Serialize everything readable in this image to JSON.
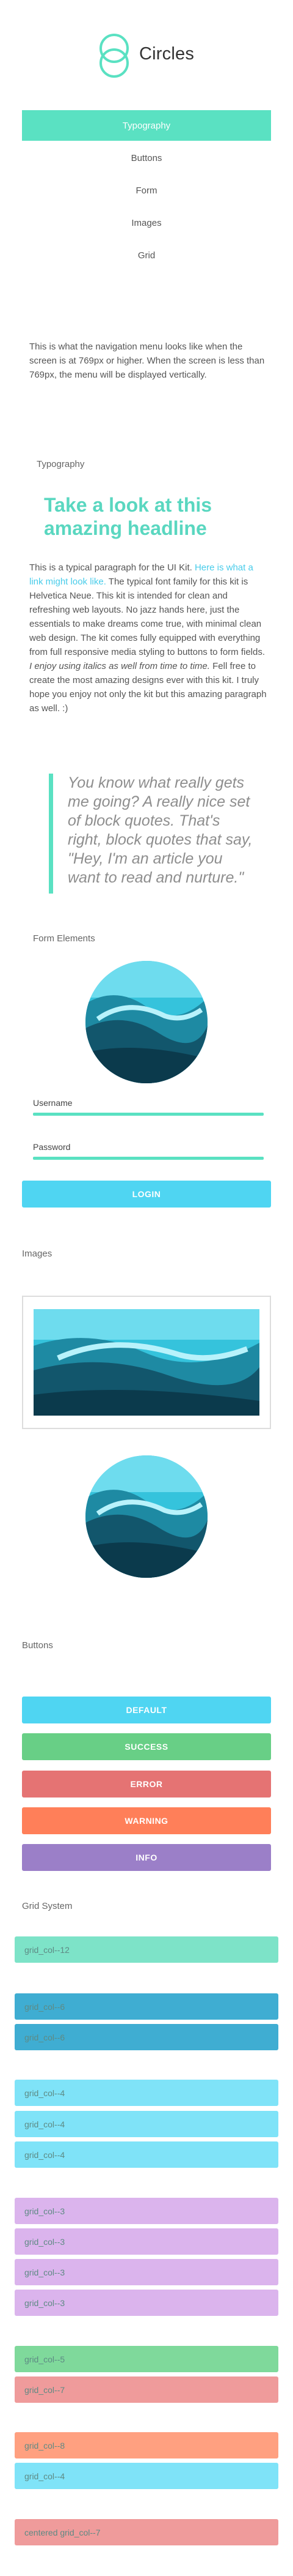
{
  "brand": {
    "name": "Circles"
  },
  "nav": {
    "items": [
      {
        "label": "Typography",
        "active": true
      },
      {
        "label": "Buttons"
      },
      {
        "label": "Form"
      },
      {
        "label": "Images"
      },
      {
        "label": "Grid"
      }
    ]
  },
  "nav_note": "This is what the navigation menu looks like when the screen is at 769px or higher. When the screen is less than 769px, the menu will be displayed vertically.",
  "typography": {
    "section_label": "Typography",
    "headline": "Take a look at this amazing headline",
    "paragraph": {
      "intro": "This is a typical paragraph for the UI Kit. ",
      "link": "Here is what a link might look like.",
      "body1": " The typical font family for this kit is Helvetica Neue. This kit is intended for clean and refreshing web layouts. No jazz hands here, just the essentials to make dreams come true, with minimal clean web design. The kit comes fully equipped with everything from full responsive media styling to buttons to form fields. ",
      "italic": "I enjoy using italics as well from time to time.",
      "body2": " Fell free to create the most amazing designs ever with this kit. I truly hope you enjoy not only the kit but this amazing paragraph as well. :)"
    },
    "quote": "You know what really gets me going? A really nice set of block quotes. That's right, block quotes that say, \"Hey, I'm an article you want to read and nurture.\""
  },
  "form": {
    "section_label": "Form Elements",
    "username_label": "Username",
    "password_label": "Password",
    "login_label": "LOGIN"
  },
  "images": {
    "section_label": "Images"
  },
  "buttons": {
    "section_label": "Buttons",
    "items": [
      {
        "label": "DEFAULT",
        "color": "#4fd5f2"
      },
      {
        "label": "SUCCESS",
        "color": "#68cf86"
      },
      {
        "label": "ERROR",
        "color": "#e57373"
      },
      {
        "label": "WARNING",
        "color": "#ff7f59"
      },
      {
        "label": "INFO",
        "color": "#9b7fc8"
      }
    ]
  },
  "grid": {
    "section_label": "Grid System",
    "rows": [
      [
        {
          "label": "grid_col--12",
          "color": "#7de3c8"
        }
      ],
      [
        {
          "label": "grid_col--6",
          "color": "#3fadd2"
        }
      ],
      [
        {
          "label": "grid_col--6",
          "color": "#3fadd2"
        }
      ],
      [
        {
          "label": "grid_col--4",
          "color": "#7fe3f8"
        }
      ],
      [
        {
          "label": "grid_col--4",
          "color": "#7fe3f8"
        }
      ],
      [
        {
          "label": "grid_col--4",
          "color": "#7fe3f8"
        }
      ],
      [
        {
          "label": "grid_col--3",
          "color": "#dbb4ed"
        }
      ],
      [
        {
          "label": "grid_col--3",
          "color": "#dbb4ed"
        }
      ],
      [
        {
          "label": "grid_col--3",
          "color": "#dbb4ed"
        }
      ],
      [
        {
          "label": "grid_col--3",
          "color": "#dbb4ed"
        }
      ],
      [
        {
          "label": "grid_col--5",
          "color": "#7fd99b"
        }
      ],
      [
        {
          "label": "grid_col--7",
          "color": "#ef9b9b"
        }
      ],
      [
        {
          "label": "grid_col--8",
          "color": "#ffa080"
        }
      ],
      [
        {
          "label": "grid_col--4",
          "color": "#7fe3f8"
        }
      ],
      [
        {
          "label": "centered grid_col--7",
          "color": "#ef9b9b"
        }
      ]
    ]
  },
  "icons": {
    "logo": "overlapping-circles-logo"
  }
}
